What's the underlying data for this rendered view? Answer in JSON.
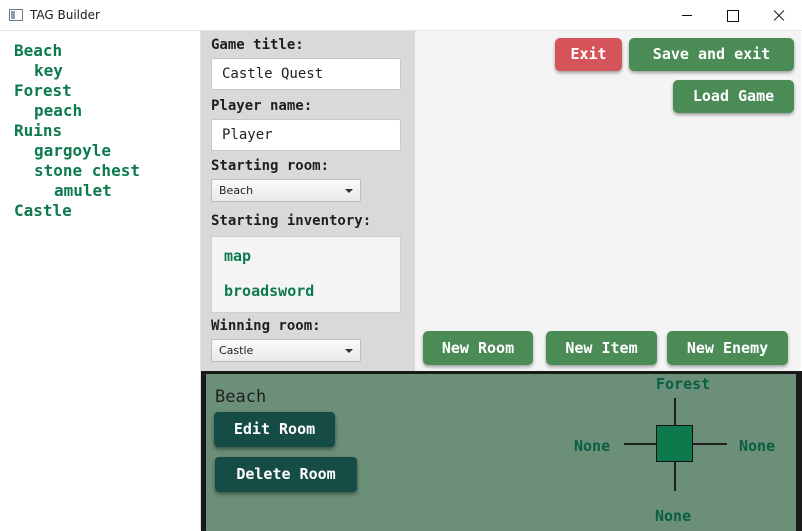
{
  "window": {
    "title": "TAG Builder"
  },
  "tree": {
    "items": [
      {
        "label": "Beach",
        "level": 0
      },
      {
        "label": "key",
        "level": 1
      },
      {
        "label": "Forest",
        "level": 0
      },
      {
        "label": "peach",
        "level": 1
      },
      {
        "label": "Ruins",
        "level": 0
      },
      {
        "label": "gargoyle",
        "level": 1
      },
      {
        "label": "stone chest",
        "level": 1
      },
      {
        "label": "amulet",
        "level": 2
      },
      {
        "label": "Castle",
        "level": 0
      }
    ]
  },
  "form": {
    "game_title_label": "Game title:",
    "game_title_value": "Castle Quest",
    "player_name_label": "Player name:",
    "player_name_value": "Player",
    "starting_room_label": "Starting room:",
    "starting_room_value": "Beach",
    "starting_inventory_label": "Starting inventory:",
    "inventory": [
      "map",
      "broadsword"
    ],
    "winning_room_label": "Winning room:",
    "winning_room_value": "Castle"
  },
  "actions": {
    "exit": "Exit",
    "save_and_exit": "Save and exit",
    "load_game": "Load Game",
    "new_room": "New Room",
    "new_item": "New Item",
    "new_enemy": "New Enemy"
  },
  "room": {
    "title": "Beach",
    "edit": "Edit Room",
    "delete": "Delete Room",
    "north": "Forest",
    "south": "None",
    "east": "None",
    "west": "None"
  },
  "colors": {
    "accent_green_text": "#0d7a4e",
    "button_green": "#4a8b56",
    "button_red": "#d5545a",
    "room_panel": "#6c8f79",
    "button_dark": "#154c46"
  }
}
